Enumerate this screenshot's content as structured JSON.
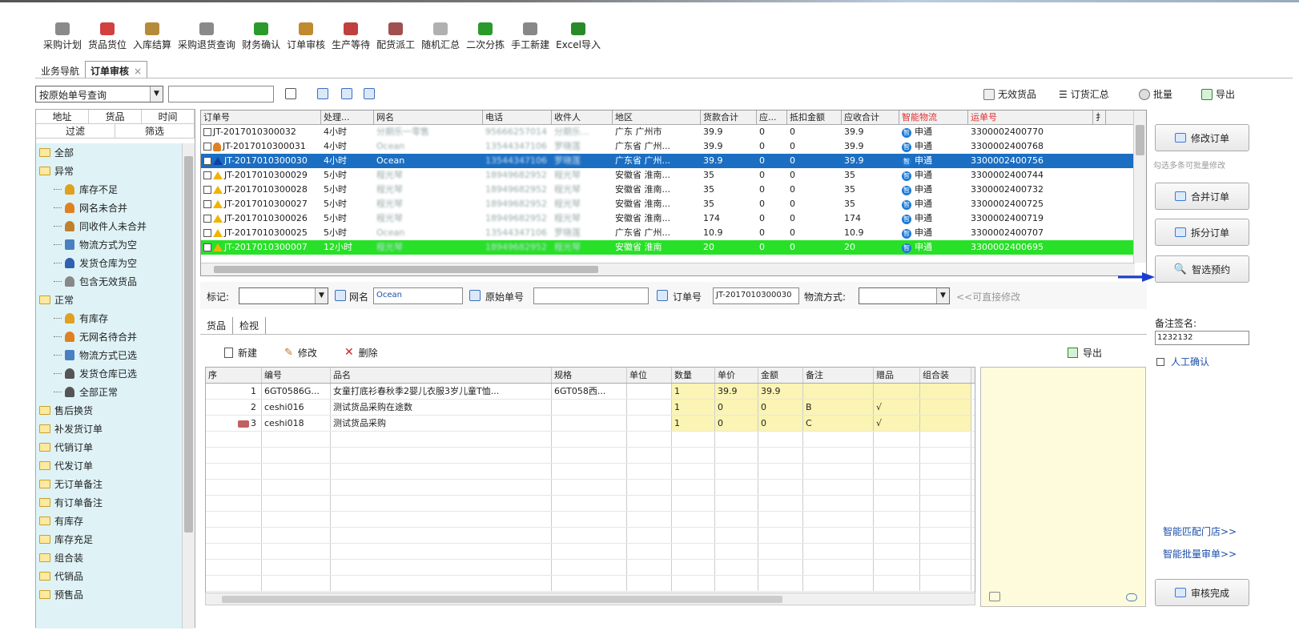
{
  "toolbar": {
    "items": [
      {
        "label": "采购计划",
        "icon": "purchase-plan-icon",
        "color": "#8a8a8a"
      },
      {
        "label": "货品货位",
        "icon": "goods-location-icon",
        "color": "#d24040"
      },
      {
        "label": "入库结算",
        "icon": "inbound-settle-icon",
        "color": "#b58b3a"
      },
      {
        "label": "采购退货查询",
        "icon": "purchase-return-icon",
        "color": "#8a8a8a"
      },
      {
        "label": "财务确认",
        "icon": "dollar-icon",
        "color": "#2a9a2a"
      },
      {
        "label": "订单审核",
        "icon": "order-review-icon",
        "color": "#c08a30"
      },
      {
        "label": "生产等待",
        "icon": "production-wait-icon",
        "color": "#c04040"
      },
      {
        "label": "配货派工",
        "icon": "dispatch-icon",
        "color": "#a05050"
      },
      {
        "label": "随机汇总",
        "icon": "random-summary-icon",
        "color": "#b0b0b0"
      },
      {
        "label": "二次分拣",
        "icon": "secondary-sort-icon",
        "color": "#2a9a2a"
      },
      {
        "label": "手工新建",
        "icon": "manual-new-icon",
        "color": "#888888"
      },
      {
        "label": "Excel导入",
        "icon": "excel-import-icon",
        "color": "#2a8a2a"
      }
    ]
  },
  "tabs": [
    {
      "label": "业务导航"
    },
    {
      "label": "订单审核",
      "close": "×"
    }
  ],
  "query": {
    "mode": "按原始单号查询"
  },
  "right_links": [
    {
      "label": "无效货品",
      "icon": "invalid-goods-icon"
    },
    {
      "label": "订货汇总",
      "icon": "order-summary-icon"
    },
    {
      "label": "批量",
      "icon": "batch-icon"
    },
    {
      "label": "导出",
      "icon": "export-icon"
    }
  ],
  "left_tabs": {
    "top": [
      "地址",
      "货品",
      "时间"
    ],
    "bottom": [
      "过滤",
      "筛选"
    ]
  },
  "tree": [
    {
      "label": "全部",
      "type": "folder",
      "level": 0
    },
    {
      "label": "异常",
      "type": "folder",
      "level": 0
    },
    {
      "label": "库存不足",
      "type": "person",
      "level": 1,
      "color": "#e0a020"
    },
    {
      "label": "网名未合并",
      "type": "person",
      "level": 1,
      "color": "#e08020"
    },
    {
      "label": "同收件人未合并",
      "type": "person",
      "level": 1,
      "color": "#c08030"
    },
    {
      "label": "物流方式为空",
      "type": "truck",
      "level": 1,
      "color": "#4a80c0"
    },
    {
      "label": "发货仓库为空",
      "type": "person",
      "level": 1,
      "color": "#3060b0"
    },
    {
      "label": "包含无效货品",
      "type": "person",
      "level": 1,
      "color": "#888888"
    },
    {
      "label": "正常",
      "type": "folder",
      "level": 0
    },
    {
      "label": "有库存",
      "type": "person",
      "level": 1,
      "color": "#e0a020"
    },
    {
      "label": "无网名待合并",
      "type": "person",
      "level": 1,
      "color": "#e08020"
    },
    {
      "label": "物流方式已选",
      "type": "truck",
      "level": 1,
      "color": "#4a80c0"
    },
    {
      "label": "发货仓库已选",
      "type": "person",
      "level": 1,
      "color": "#555555"
    },
    {
      "label": "全部正常",
      "type": "person",
      "level": 1,
      "color": "#555555"
    },
    {
      "label": "售后换货",
      "type": "folder",
      "level": 0
    },
    {
      "label": "补发货订单",
      "type": "folder",
      "level": 0
    },
    {
      "label": "代销订单",
      "type": "folder",
      "level": 0
    },
    {
      "label": "代发订单",
      "type": "folder",
      "level": 0
    },
    {
      "label": "无订单备注",
      "type": "folder",
      "level": 0
    },
    {
      "label": "有订单备注",
      "type": "folder",
      "level": 0
    },
    {
      "label": "有库存",
      "type": "folder",
      "level": 0
    },
    {
      "label": "库存充足",
      "type": "folder",
      "level": 0
    },
    {
      "label": "组合装",
      "type": "folder",
      "level": 0
    },
    {
      "label": "代销品",
      "type": "folder",
      "level": 0
    },
    {
      "label": "预售品",
      "type": "folder",
      "level": 0
    }
  ],
  "grid": {
    "headers": [
      "订单号",
      "处理...",
      "网名",
      "电话",
      "收件人",
      "地区",
      "货款合计",
      "应...",
      "抵扣金额",
      "应收合计",
      "智能物流",
      "运单号",
      "扌"
    ],
    "rows": [
      {
        "flag": "none",
        "order": "JT-2017010300032",
        "time": "4小时",
        "net": "分期乐一零售",
        "phone": "95666257014",
        "rcpt": "分期乐...",
        "area": "广东 广州市",
        "goods": "39.9",
        "y": "0",
        "deduct": "0",
        "total": "39.9",
        "logistics": "申通",
        "waybill": "3300002400770",
        "state": "normal",
        "netBlur": true
      },
      {
        "flag": "person",
        "order": "JT-2017010300031",
        "time": "4小时",
        "net": "Ocean",
        "phone": "13544347106",
        "rcpt": "罗晓莲",
        "area": "广东省 广州...",
        "goods": "39.9",
        "y": "0",
        "deduct": "0",
        "total": "39.9",
        "logistics": "申通",
        "waybill": "3300002400768",
        "state": "normal",
        "netBlur": true
      },
      {
        "flag": "warn-blue",
        "order": "JT-2017010300030",
        "time": "4小时",
        "net": "Ocean",
        "phone": "13544347106",
        "rcpt": "罗晓莲",
        "area": "广东省 广州...",
        "goods": "39.9",
        "y": "0",
        "deduct": "0",
        "total": "39.9",
        "logistics": "申通",
        "waybill": "3300002400756",
        "state": "selected",
        "netBlur": false
      },
      {
        "flag": "warn",
        "order": "JT-2017010300029",
        "time": "5小时",
        "net": "程光琴",
        "phone": "18949682952",
        "rcpt": "程光琴",
        "area": "安徽省 淮南...",
        "goods": "35",
        "y": "0",
        "deduct": "0",
        "total": "35",
        "logistics": "申通",
        "waybill": "3300002400744",
        "state": "normal",
        "netBlur": true
      },
      {
        "flag": "warn",
        "order": "JT-2017010300028",
        "time": "5小时",
        "net": "程光琴",
        "phone": "18949682952",
        "rcpt": "程光琴",
        "area": "安徽省 淮南...",
        "goods": "35",
        "y": "0",
        "deduct": "0",
        "total": "35",
        "logistics": "申通",
        "waybill": "3300002400732",
        "state": "normal",
        "netBlur": true
      },
      {
        "flag": "warn",
        "order": "JT-2017010300027",
        "time": "5小时",
        "net": "程光琴",
        "phone": "18949682952",
        "rcpt": "程光琴",
        "area": "安徽省 淮南...",
        "goods": "35",
        "y": "0",
        "deduct": "0",
        "total": "35",
        "logistics": "申通",
        "waybill": "3300002400725",
        "state": "normal",
        "netBlur": true
      },
      {
        "flag": "warn",
        "order": "JT-2017010300026",
        "time": "5小时",
        "net": "程光琴",
        "phone": "18949682952",
        "rcpt": "程光琴",
        "area": "安徽省 淮南...",
        "goods": "174",
        "y": "0",
        "deduct": "0",
        "total": "174",
        "logistics": "申通",
        "waybill": "3300002400719",
        "state": "normal",
        "netBlur": true
      },
      {
        "flag": "warn",
        "order": "JT-2017010300025",
        "time": "5小时",
        "net": "Ocean",
        "phone": "13544347106",
        "rcpt": "罗晓莲",
        "area": "广东省 广州...",
        "goods": "10.9",
        "y": "0",
        "deduct": "0",
        "total": "10.9",
        "logistics": "申通",
        "waybill": "3300002400707",
        "state": "normal",
        "netBlur": true
      },
      {
        "flag": "warn",
        "order": "JT-2017010300007",
        "time": "12小时",
        "net": "程光琴",
        "phone": "18949682952",
        "rcpt": "程光琴",
        "area": "安徽省 淮南",
        "goods": "20",
        "y": "0",
        "deduct": "0",
        "total": "20",
        "logistics": "申通",
        "waybill": "3300002400695",
        "state": "green",
        "netBlur": true
      }
    ]
  },
  "filter": {
    "mark_label": "标记:",
    "net_label": "网名",
    "net_value": "Ocean",
    "orig_label": "原始单号",
    "order_label": "订单号",
    "order_value": "JT-2017010300030",
    "ship_label": "物流方式:",
    "hint": "<<可直接修改"
  },
  "detail_tabs": [
    "货品",
    "检视"
  ],
  "detail_toolbar": {
    "new": "新建",
    "edit": "修改",
    "del": "删除",
    "export": "导出"
  },
  "detail": {
    "headers": [
      "序",
      "编号",
      "品名",
      "规格",
      "单位",
      "数量",
      "单价",
      "金额",
      "备注",
      "赠品",
      "组合装"
    ],
    "rows": [
      {
        "seq": "1",
        "code": "6GT0586G...",
        "name": "女童打底衫春秋季2婴儿衣服3岁儿童T恤...",
        "spec": "6GT058西...",
        "unit": "",
        "qty": "1",
        "price": "39.9",
        "amount": "39.9",
        "note": "",
        "gift": "",
        "combo": ""
      },
      {
        "seq": "2",
        "code": "ceshi016",
        "name": "测试货品采购在途数",
        "spec": "",
        "unit": "",
        "qty": "1",
        "price": "0",
        "amount": "0",
        "note": "B",
        "gift": "√",
        "combo": ""
      },
      {
        "seq": "3",
        "code": "ceshi018",
        "name": "测试货品采购",
        "spec": "",
        "unit": "",
        "qty": "1",
        "price": "0",
        "amount": "0",
        "note": "C",
        "gift": "√",
        "combo": ""
      }
    ]
  },
  "right_panel": {
    "modify": "修改订单",
    "hint": "勾选多条可批量修改",
    "merge": "合并订单",
    "split": "拆分订单",
    "smart": "智选预约",
    "remark_label": "备注签名:",
    "remark_value": "1232132",
    "manual": "人工确认",
    "link1": "智能匹配门店>>",
    "link2": "智能批量审单>>",
    "done": "审核完成"
  },
  "colors": {
    "selected_row": "#1b6ec2",
    "green_row": "#28e028",
    "tree_bg": "#dff3f7",
    "notes_bg": "#fdfbdc",
    "highlight_cols": "#fbf4b4",
    "header_red": "#e03030",
    "arrow": "#1a3fd0"
  }
}
